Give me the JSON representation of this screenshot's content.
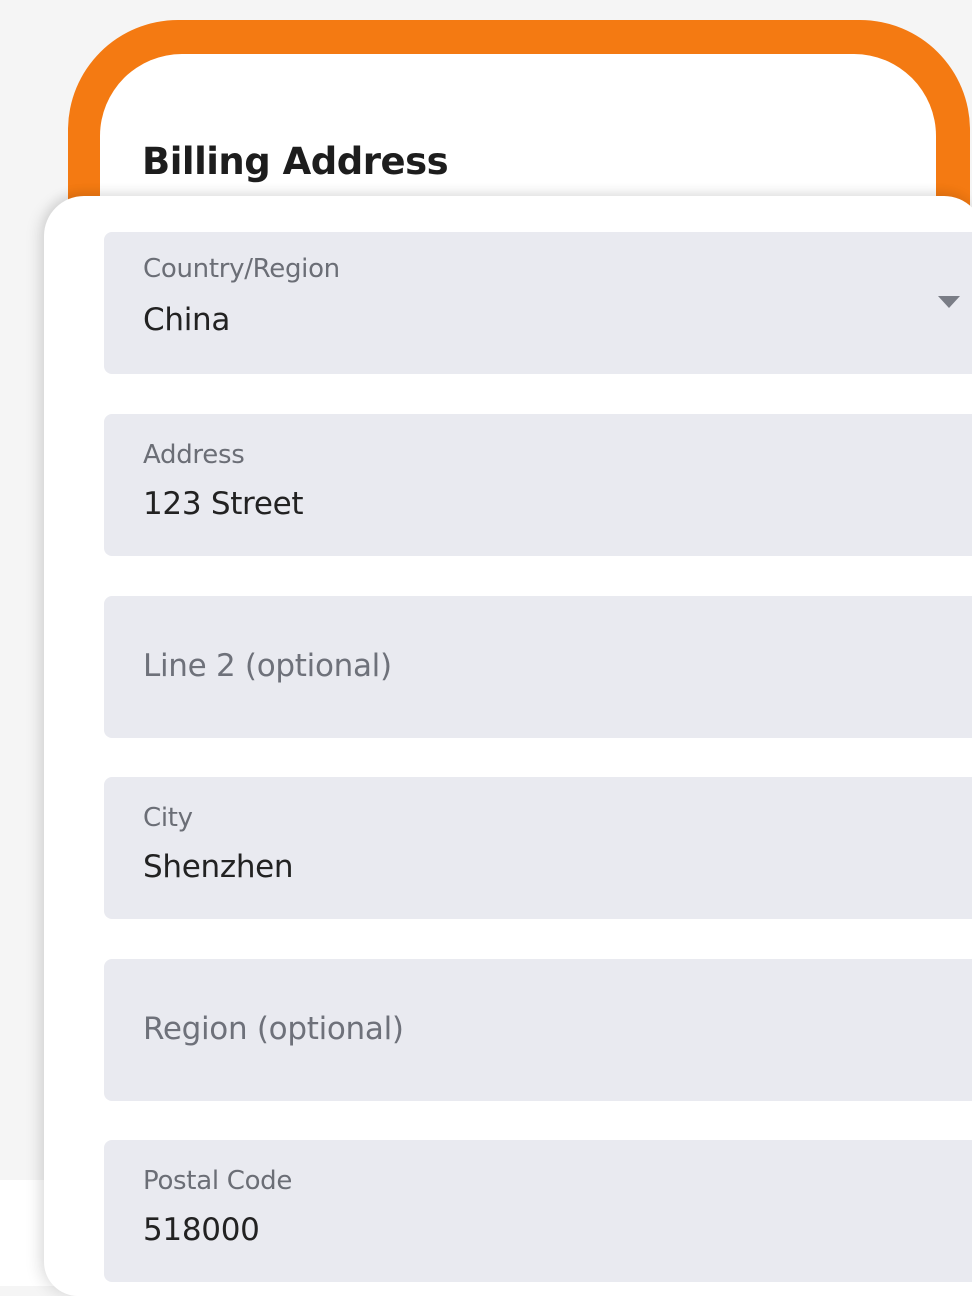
{
  "form": {
    "title": "Billing Address",
    "country": {
      "label": "Country/Region",
      "value": "China"
    },
    "address": {
      "label": "Address",
      "value": "123 Street"
    },
    "line2": {
      "placeholder": "Line 2 (optional)"
    },
    "city": {
      "label": "City",
      "value": "Shenzhen"
    },
    "region": {
      "placeholder": "Region (optional)"
    },
    "postal": {
      "label": "Postal Code",
      "value": "518000"
    }
  },
  "colors": {
    "accent_orange": "#f47a12",
    "field_background": "#e9eaf0"
  },
  "icons": {
    "country_dropdown": "caret-down-icon"
  }
}
